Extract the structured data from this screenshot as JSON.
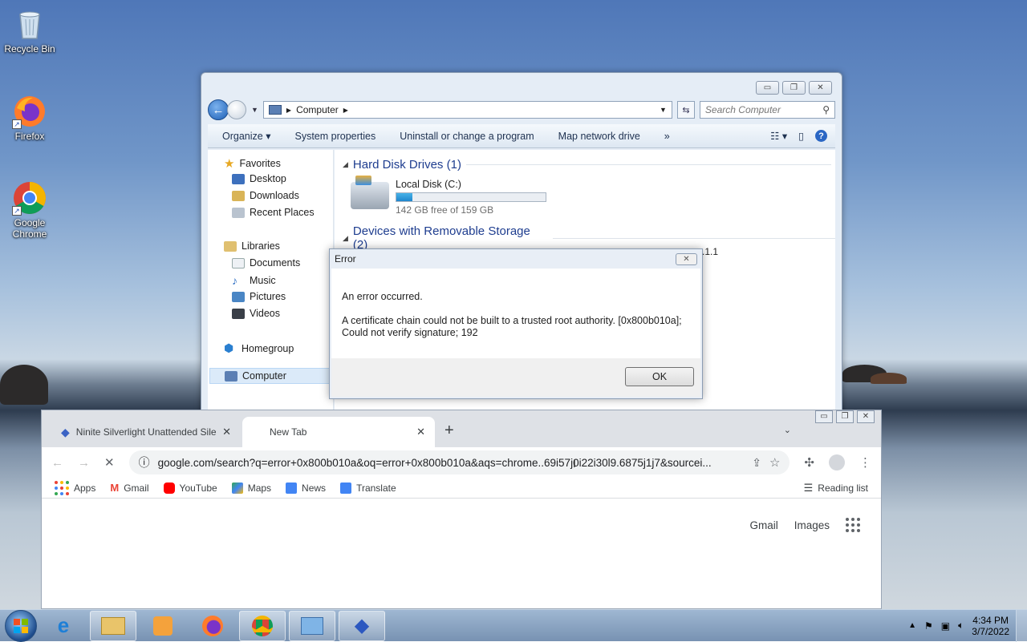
{
  "desktop": {
    "icons": [
      {
        "label": "Recycle Bin"
      },
      {
        "label": "Firefox"
      },
      {
        "label": "Google Chrome"
      }
    ]
  },
  "explorer": {
    "breadcrumb": "Computer",
    "search_placeholder": "Search Computer",
    "commands": [
      "Organize",
      "System properties",
      "Uninstall or change a program",
      "Map network drive",
      "»"
    ],
    "nav": {
      "favorites": "Favorites",
      "desktop": "Desktop",
      "downloads": "Downloads",
      "recent": "Recent Places",
      "libraries": "Libraries",
      "documents": "Documents",
      "music": "Music",
      "pictures": "Pictures",
      "videos": "Videos",
      "homegroup": "Homegroup",
      "computer": "Computer"
    },
    "hdd_header": "Hard Disk Drives (1)",
    "disk_name": "Local Disk (C:)",
    "disk_free": "142 GB free of 159 GB",
    "disk_used_fraction": 0.107,
    "removable_header": "Devices with Removable Storage (2)",
    "partial_text": ".1.1"
  },
  "dialog": {
    "title": "Error",
    "line1": "An error occurred.",
    "line2": "A certificate chain could not be built to a trusted root authority. [0x800b010a];",
    "line3": "Could not verify signature; 192",
    "ok": "OK"
  },
  "chrome": {
    "tabs": [
      {
        "title": "Ninite Silverlight Unattended Sile"
      },
      {
        "title": "New Tab"
      }
    ],
    "url": "google.com/search?q=error+0x800b010a&oq=error+0x800b010a&aqs=chrome..69i57j0i22i30l9.6875j1j7&sourcei...",
    "bookmarks": [
      "Apps",
      "Gmail",
      "YouTube",
      "Maps",
      "News",
      "Translate"
    ],
    "reading_list": "Reading list",
    "page_links": {
      "gmail": "Gmail",
      "images": "Images"
    }
  },
  "taskbar": {
    "time": "4:34 PM",
    "date": "3/7/2022"
  }
}
